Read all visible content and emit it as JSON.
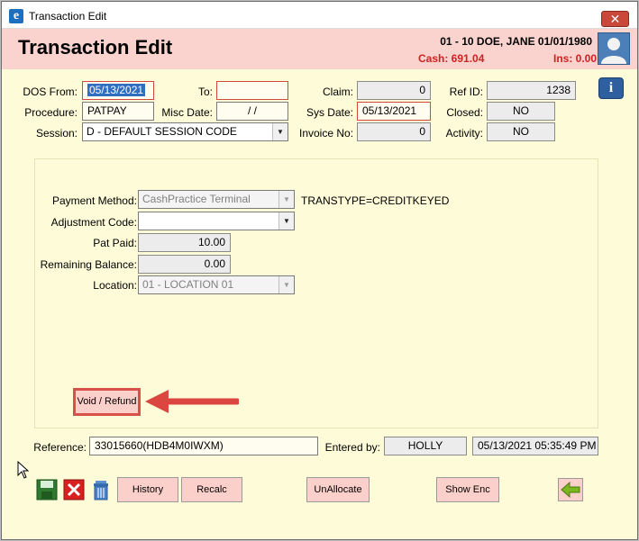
{
  "window": {
    "title": "Transaction Edit",
    "close_glyph": "✕"
  },
  "header": {
    "title": "Transaction Edit",
    "patient": "01 - 10 DOE, JANE 01/01/1980",
    "cash": "Cash: 691.04",
    "ins": "Ins: 0.00"
  },
  "form": {
    "dos_from_label": "DOS From:",
    "dos_from": "05/13/2021",
    "to_label": "To:",
    "to": "",
    "claim_label": "Claim:",
    "claim": "0",
    "ref_id_label": "Ref ID:",
    "ref_id": "1238",
    "procedure_label": "Procedure:",
    "procedure": "PATPAY",
    "misc_date_label": "Misc Date:",
    "misc_date": " /  /",
    "sys_date_label": "Sys Date:",
    "sys_date": "05/13/2021",
    "closed_label": "Closed:",
    "closed": "NO",
    "session_label": "Session:",
    "session": "D - DEFAULT SESSION CODE",
    "invoice_label": "Invoice No:",
    "invoice": "0",
    "activity_label": "Activity:",
    "activity": "NO"
  },
  "payment": {
    "method_label": "Payment Method:",
    "method": "CashPractice Terminal",
    "transtype": "TRANSTYPE=CREDITKEYED",
    "adjustment_label": "Adjustment Code:",
    "adjustment": "",
    "pat_paid_label": "Pat Paid:",
    "pat_paid": "10.00",
    "remaining_label": "Remaining Balance:",
    "remaining": "0.00",
    "location_label": "Location:",
    "location": "01 - LOCATION 01",
    "void_refund_label": "Void / Refund"
  },
  "footer": {
    "reference_label": "Reference:",
    "reference": "33015660(HDB4M0IWXM)",
    "entered_by_label": "Entered by:",
    "entered_by": "HOLLY",
    "entered_time": "05/13/2021 05:35:49 PM"
  },
  "buttons": {
    "history": "History",
    "recalc": "Recalc",
    "unallocate": "UnAllocate",
    "show_enc": "Show Enc"
  },
  "icons": {
    "app": "app-e-icon",
    "info": "info-icon",
    "save": "save-icon",
    "cancel": "cancel-icon",
    "delete": "trash-icon",
    "back": "back-arrow-icon",
    "annotation": "red-arrow-icon",
    "cursor": "mouse-cursor-icon"
  },
  "colors": {
    "header_bg": "#fad3ce",
    "window_bg": "#fefbd8",
    "accent_red": "#d02020",
    "button_bg": "#fcd0ca"
  }
}
